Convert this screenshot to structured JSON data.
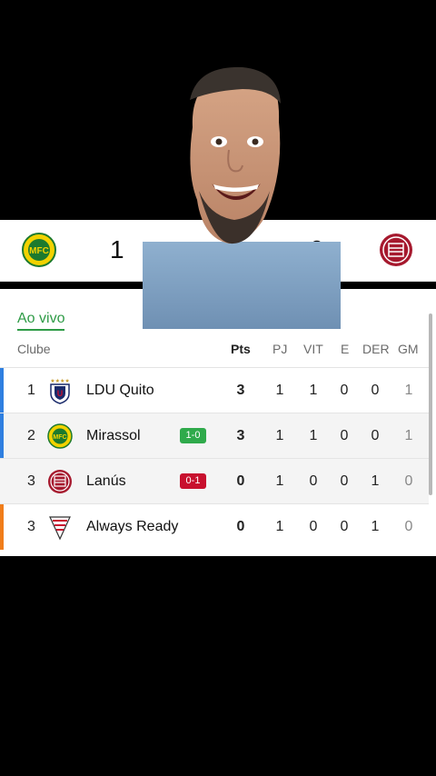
{
  "match": {
    "home": {
      "score": "1",
      "crest_icon": "mirassol-crest-icon",
      "color": "#f2d200"
    },
    "away": {
      "score": "0",
      "crest_icon": "lanus-crest-icon",
      "color": "#a6192e"
    }
  },
  "tabs": {
    "live_label": "Ao vivo"
  },
  "table": {
    "columns": {
      "club": "Clube",
      "pts": "Pts",
      "pj": "PJ",
      "vit": "VIT",
      "e": "E",
      "der": "DER",
      "gm": "GM"
    },
    "rows": [
      {
        "pos": "1",
        "name": "LDU Quito",
        "logo_icon": "ldu-quito-crest-icon",
        "pts": "3",
        "pj": "1",
        "vit": "1",
        "e": "0",
        "der": "0",
        "gm": "1",
        "live_score": "",
        "bar_color": "#2f7fe0"
      },
      {
        "pos": "2",
        "name": "Mirassol",
        "logo_icon": "mirassol-crest-icon",
        "pts": "3",
        "pj": "1",
        "vit": "1",
        "e": "0",
        "der": "0",
        "gm": "1",
        "live_score": "1-0",
        "live_color": "#2faa4b",
        "bar_color": "#2f7fe0"
      },
      {
        "pos": "3",
        "name": "Lanús",
        "logo_icon": "lanus-crest-icon",
        "pts": "0",
        "pj": "1",
        "vit": "0",
        "e": "0",
        "der": "1",
        "gm": "0",
        "live_score": "0-1",
        "live_color": "#c8102e",
        "bar_color": ""
      },
      {
        "pos": "3",
        "name": "Always Ready",
        "logo_icon": "always-ready-crest-icon",
        "pts": "0",
        "pj": "1",
        "vit": "0",
        "e": "0",
        "der": "1",
        "gm": "0",
        "live_score": "",
        "bar_color": "#f07d1a"
      }
    ]
  },
  "colors": {
    "accent_green": "#2e9b46",
    "qualify_blue": "#2f7fe0",
    "sudamericana_orange": "#f07d1a"
  }
}
